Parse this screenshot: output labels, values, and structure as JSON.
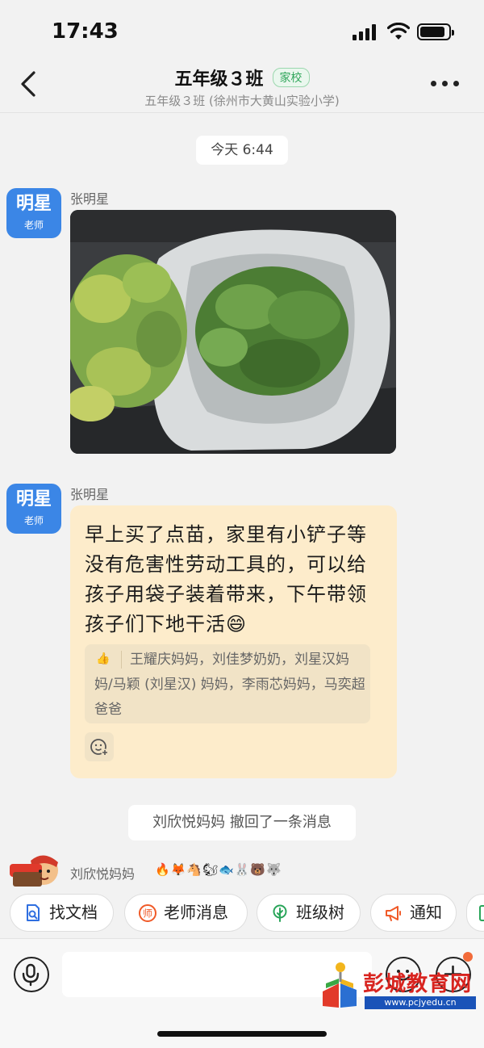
{
  "status_bar": {
    "time": "17:43"
  },
  "header": {
    "title": "五年级３班",
    "tag": "家校",
    "subtitle": "五年级３班 (徐州市大黄山实验小学)"
  },
  "chat": {
    "date_chip": "今天 6:44",
    "messages": [
      {
        "sender": "张明星",
        "avatar_name": "明星",
        "avatar_role": "老师",
        "type": "image"
      },
      {
        "sender": "张明星",
        "avatar_name": "明星",
        "avatar_role": "老师",
        "type": "text",
        "text": "早上买了点苗，家里有小铲子等没有危害性劳动工具的，可以给孩子用袋子装着带来，下午带领孩子们下地干活😄",
        "reactions": "王耀庆妈妈，刘佳梦奶奶，刘星汉妈妈/马颖 (刘星汉) 妈妈，李雨芯妈妈，马奕超爸爸"
      }
    ],
    "recall_notice": "刘欣悦妈妈 撤回了一条消息",
    "typing_user": "刘欣悦妈妈",
    "typing_emojis": "🔥🦊🐴🐿🐟🐰🐻🐺"
  },
  "quick_actions": [
    {
      "label": "找文档",
      "icon": "doc-search-icon",
      "color": "#2f6fe0"
    },
    {
      "label": "老师消息",
      "icon": "teacher-icon",
      "color": "#f05a28"
    },
    {
      "label": "班级树",
      "icon": "tree-icon",
      "color": "#2aa55a"
    },
    {
      "label": "通知",
      "icon": "megaphone-icon",
      "color": "#f05a28"
    }
  ],
  "input": {
    "placeholder": ""
  },
  "watermark": {
    "name": "彭城教育网",
    "url": "www.pcjyedu.cn"
  }
}
